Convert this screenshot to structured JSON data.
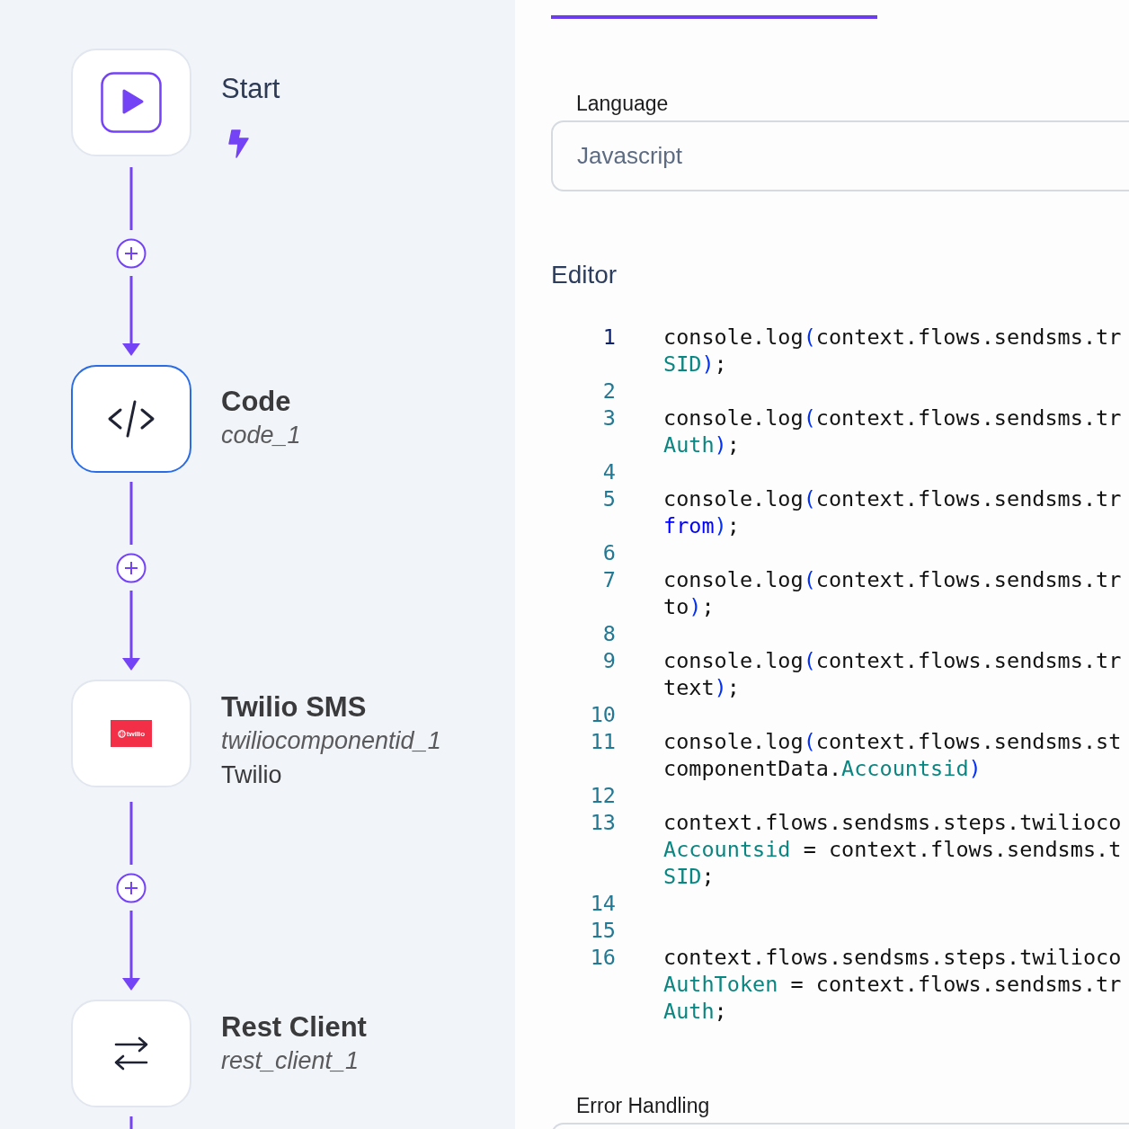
{
  "flow": {
    "nodes": [
      {
        "kind": "start",
        "selected": false,
        "title": "Start"
      },
      {
        "kind": "code",
        "selected": true,
        "title": "Code",
        "id": "code_1"
      },
      {
        "kind": "twilio",
        "selected": false,
        "title": "Twilio SMS",
        "id": "twiliocomponentid_1",
        "provider": "Twilio",
        "logo_text": "twilio"
      },
      {
        "kind": "rest",
        "selected": false,
        "title": "Rest Client",
        "id": "rest_client_1"
      }
    ]
  },
  "panel": {
    "language": {
      "label": "Language",
      "value": "Javascript"
    },
    "editor": {
      "title": "Editor",
      "lines": [
        {
          "number": "1",
          "selected": true,
          "rows": [
            {
              "spans": [
                {
                  "kind": "text",
                  "text": "console.log"
                },
                {
                  "kind": "paren",
                  "text": "("
                },
                {
                  "kind": "text",
                  "text": "context.flows.sendsms.tr"
                }
              ]
            },
            {
              "spans": [
                {
                  "kind": "prop",
                  "text": "SID"
                },
                {
                  "kind": "paren",
                  "text": ")"
                },
                {
                  "kind": "text",
                  "text": ";"
                }
              ]
            }
          ]
        },
        {
          "number": "2",
          "selected": false
        },
        {
          "number": "3",
          "selected": false,
          "rows": [
            {
              "spans": [
                {
                  "kind": "text",
                  "text": "console.log"
                },
                {
                  "kind": "paren",
                  "text": "("
                },
                {
                  "kind": "text",
                  "text": "context.flows.sendsms.tr"
                }
              ]
            },
            {
              "spans": [
                {
                  "kind": "prop",
                  "text": "Auth"
                },
                {
                  "kind": "paren",
                  "text": ")"
                },
                {
                  "kind": "text",
                  "text": ";"
                }
              ]
            }
          ]
        },
        {
          "number": "4",
          "selected": false
        },
        {
          "number": "5",
          "selected": false,
          "rows": [
            {
              "spans": [
                {
                  "kind": "text",
                  "text": "console.log"
                },
                {
                  "kind": "paren",
                  "text": "("
                },
                {
                  "kind": "text",
                  "text": "context.flows.sendsms.tr"
                }
              ]
            },
            {
              "spans": [
                {
                  "kind": "keyword",
                  "text": "from"
                },
                {
                  "kind": "paren",
                  "text": ")"
                },
                {
                  "kind": "text",
                  "text": ";"
                }
              ]
            }
          ]
        },
        {
          "number": "6",
          "selected": false
        },
        {
          "number": "7",
          "selected": false,
          "rows": [
            {
              "spans": [
                {
                  "kind": "text",
                  "text": "console.log"
                },
                {
                  "kind": "paren",
                  "text": "("
                },
                {
                  "kind": "text",
                  "text": "context.flows.sendsms.tr"
                }
              ]
            },
            {
              "spans": [
                {
                  "kind": "text",
                  "text": "to"
                },
                {
                  "kind": "paren",
                  "text": ")"
                },
                {
                  "kind": "text",
                  "text": ";"
                }
              ]
            }
          ]
        },
        {
          "number": "8",
          "selected": false
        },
        {
          "number": "9",
          "selected": false,
          "rows": [
            {
              "spans": [
                {
                  "kind": "text",
                  "text": "console.log"
                },
                {
                  "kind": "paren",
                  "text": "("
                },
                {
                  "kind": "text",
                  "text": "context.flows.sendsms.tr"
                }
              ]
            },
            {
              "spans": [
                {
                  "kind": "text",
                  "text": "text"
                },
                {
                  "kind": "paren",
                  "text": ")"
                },
                {
                  "kind": "text",
                  "text": ";"
                }
              ]
            }
          ]
        },
        {
          "number": "10",
          "selected": false
        },
        {
          "number": "11",
          "selected": false,
          "rows": [
            {
              "spans": [
                {
                  "kind": "text",
                  "text": "console.log"
                },
                {
                  "kind": "paren",
                  "text": "("
                },
                {
                  "kind": "text",
                  "text": "context.flows.sendsms.st"
                }
              ]
            },
            {
              "spans": [
                {
                  "kind": "text",
                  "text": "componentData."
                },
                {
                  "kind": "prop",
                  "text": "Accountsid"
                },
                {
                  "kind": "paren",
                  "text": ")"
                }
              ]
            }
          ]
        },
        {
          "number": "12",
          "selected": false
        },
        {
          "number": "13",
          "selected": false,
          "rows": [
            {
              "spans": [
                {
                  "kind": "text",
                  "text": "context.flows.sendsms.steps.twilioco"
                }
              ]
            },
            {
              "spans": [
                {
                  "kind": "prop",
                  "text": "Accountsid"
                },
                {
                  "kind": "text",
                  "text": " = context.flows.sendsms.t"
                }
              ]
            },
            {
              "spans": [
                {
                  "kind": "prop",
                  "text": "SID"
                },
                {
                  "kind": "text",
                  "text": ";"
                }
              ]
            }
          ]
        },
        {
          "number": "14",
          "selected": false
        },
        {
          "number": "15",
          "selected": false
        },
        {
          "number": "16",
          "selected": false,
          "rows": [
            {
              "spans": [
                {
                  "kind": "text",
                  "text": "context.flows.sendsms.steps.twilioco"
                }
              ]
            },
            {
              "spans": [
                {
                  "kind": "prop",
                  "text": "AuthToken"
                },
                {
                  "kind": "text",
                  "text": " = context.flows.sendsms.tr"
                }
              ]
            },
            {
              "spans": [
                {
                  "kind": "prop",
                  "text": "Auth"
                },
                {
                  "kind": "text",
                  "text": ";"
                }
              ]
            }
          ]
        }
      ]
    },
    "error_handling": {
      "label": "Error Handling"
    }
  }
}
